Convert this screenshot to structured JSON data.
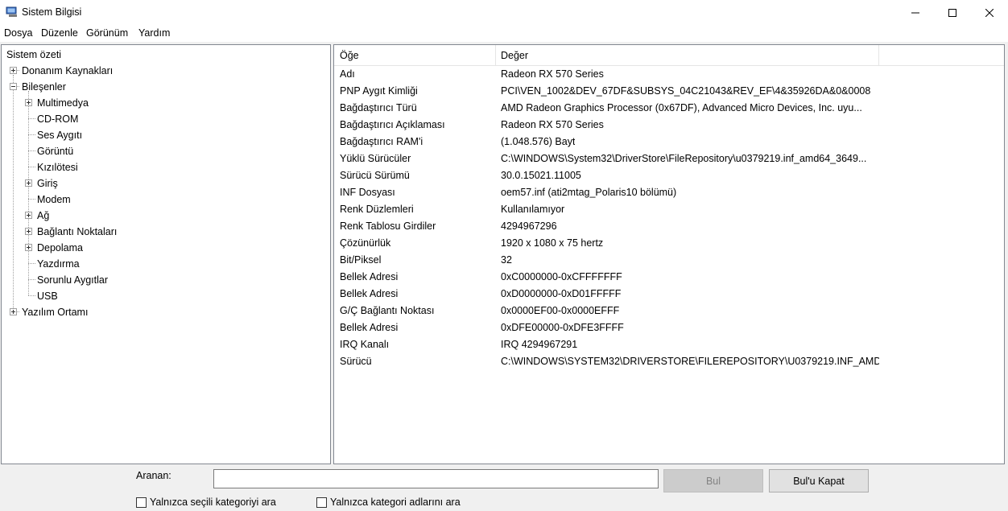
{
  "window": {
    "title": "Sistem Bilgisi"
  },
  "menu": [
    "Dosya",
    "Düzenle",
    "Görünüm",
    "Yardım"
  ],
  "tree": [
    {
      "label": "Sistem özeti",
      "level": 0,
      "expander": "none"
    },
    {
      "label": "Donanım Kaynakları",
      "level": 1,
      "expander": "plus"
    },
    {
      "label": "Bileşenler",
      "level": 1,
      "expander": "minus"
    },
    {
      "label": "Multimedya",
      "level": 2,
      "expander": "plus"
    },
    {
      "label": "CD-ROM",
      "level": 2,
      "expander": "none"
    },
    {
      "label": "Ses Aygıtı",
      "level": 2,
      "expander": "none"
    },
    {
      "label": "Görüntü",
      "level": 2,
      "expander": "none"
    },
    {
      "label": "Kızılötesi",
      "level": 2,
      "expander": "none"
    },
    {
      "label": "Giriş",
      "level": 2,
      "expander": "plus"
    },
    {
      "label": "Modem",
      "level": 2,
      "expander": "none"
    },
    {
      "label": "Ağ",
      "level": 2,
      "expander": "plus"
    },
    {
      "label": "Bağlantı Noktaları",
      "level": 2,
      "expander": "plus"
    },
    {
      "label": "Depolama",
      "level": 2,
      "expander": "plus"
    },
    {
      "label": "Yazdırma",
      "level": 2,
      "expander": "none"
    },
    {
      "label": "Sorunlu Aygıtlar",
      "level": 2,
      "expander": "none"
    },
    {
      "label": "USB",
      "level": 2,
      "expander": "none"
    },
    {
      "label": "Yazılım Ortamı",
      "level": 1,
      "expander": "plus"
    }
  ],
  "details": {
    "columns": [
      "Öğe",
      "Değer"
    ],
    "rows": [
      [
        "Adı",
        "Radeon RX 570 Series"
      ],
      [
        "PNP Aygıt Kimliği",
        "PCI\\VEN_1002&DEV_67DF&SUBSYS_04C21043&REV_EF\\4&35926DA&0&0008"
      ],
      [
        "Bağdaştırıcı Türü",
        "AMD Radeon Graphics Processor (0x67DF), Advanced Micro Devices, Inc. uyu..."
      ],
      [
        "Bağdaştırıcı Açıklaması",
        "Radeon RX 570 Series"
      ],
      [
        "Bağdaştırıcı RAM'i",
        "(1.048.576) Bayt"
      ],
      [
        "Yüklü Sürücüler",
        "C:\\WINDOWS\\System32\\DriverStore\\FileRepository\\u0379219.inf_amd64_3649..."
      ],
      [
        "Sürücü Sürümü",
        "30.0.15021.11005"
      ],
      [
        "INF Dosyası",
        "oem57.inf (ati2mtag_Polaris10 bölümü)"
      ],
      [
        "Renk Düzlemleri",
        "Kullanılamıyor"
      ],
      [
        "Renk Tablosu Girdiler",
        "4294967296"
      ],
      [
        "Çözünürlük",
        "1920 x 1080 x 75 hertz"
      ],
      [
        "Bit/Piksel",
        "32"
      ],
      [
        "Bellek Adresi",
        "0xC0000000-0xCFFFFFFF"
      ],
      [
        "Bellek Adresi",
        "0xD0000000-0xD01FFFFF"
      ],
      [
        "G/Ç Bağlantı Noktası",
        "0x0000EF00-0x0000EFFF"
      ],
      [
        "Bellek Adresi",
        "0xDFE00000-0xDFE3FFFF"
      ],
      [
        "IRQ Kanalı",
        "IRQ 4294967291"
      ],
      [
        "Sürücü",
        "C:\\WINDOWS\\SYSTEM32\\DRIVERSTORE\\FILEREPOSITORY\\U0379219.INF_AMD..."
      ]
    ]
  },
  "find": {
    "label": "Aranan:",
    "value": "",
    "find_button": "Bul",
    "close_find_button": "Bul'u Kapat",
    "checkbox_selected_category": "Yalnızca seçili kategoriyi ara",
    "checkbox_category_names": "Yalnızca kategori adlarını ara",
    "checkbox_selected_category_checked": false,
    "checkbox_category_names_checked": false
  },
  "colors": {
    "border": "#828790",
    "disabled_text": "#838383"
  },
  "icons": {
    "app": "system-information-icon",
    "min": "minimize-icon",
    "max": "maximize-icon",
    "close": "close-icon"
  }
}
